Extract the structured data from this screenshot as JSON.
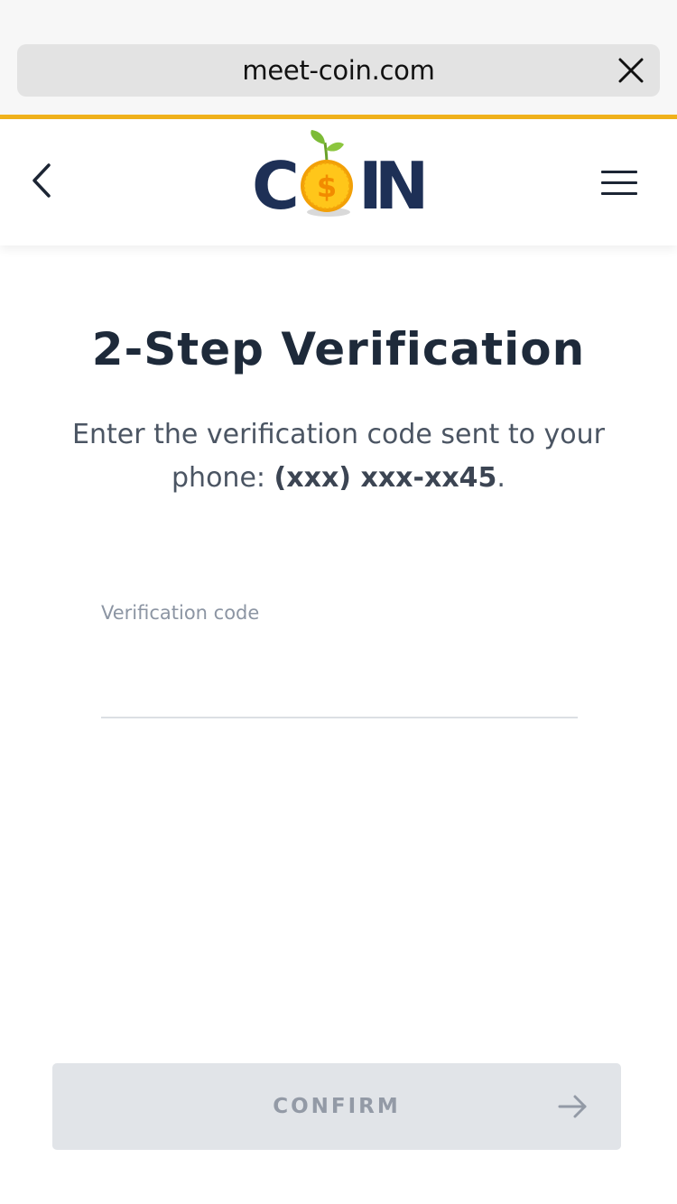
{
  "browser": {
    "url": "meet-coin.com",
    "close_icon": "close-icon"
  },
  "header": {
    "back_icon": "chevron-left-icon",
    "menu_icon": "hamburger-menu-icon",
    "logo": {
      "letter_c": "C",
      "letter_i": "I",
      "letter_n": "N",
      "coin_symbol": "$",
      "coin_icon": "dollar-coin-sprout-icon"
    }
  },
  "main": {
    "title": "2-Step Verification",
    "subtitle_prefix": "Enter the verification code sent to your phone: ",
    "masked_phone": "(xxx) xxx-xx45",
    "subtitle_suffix": ".",
    "field_label": "Verification code",
    "field_value": "",
    "confirm_label": "CONFIRM",
    "confirm_icon": "arrow-right-icon"
  },
  "colors": {
    "accent": "#f0b21c",
    "brand_navy": "#1e3056",
    "coin_gold": "#f5b50f",
    "sprout_green": "#7cbb36",
    "button_disabled_bg": "#e1e4e8",
    "button_disabled_text": "#939aa6"
  }
}
